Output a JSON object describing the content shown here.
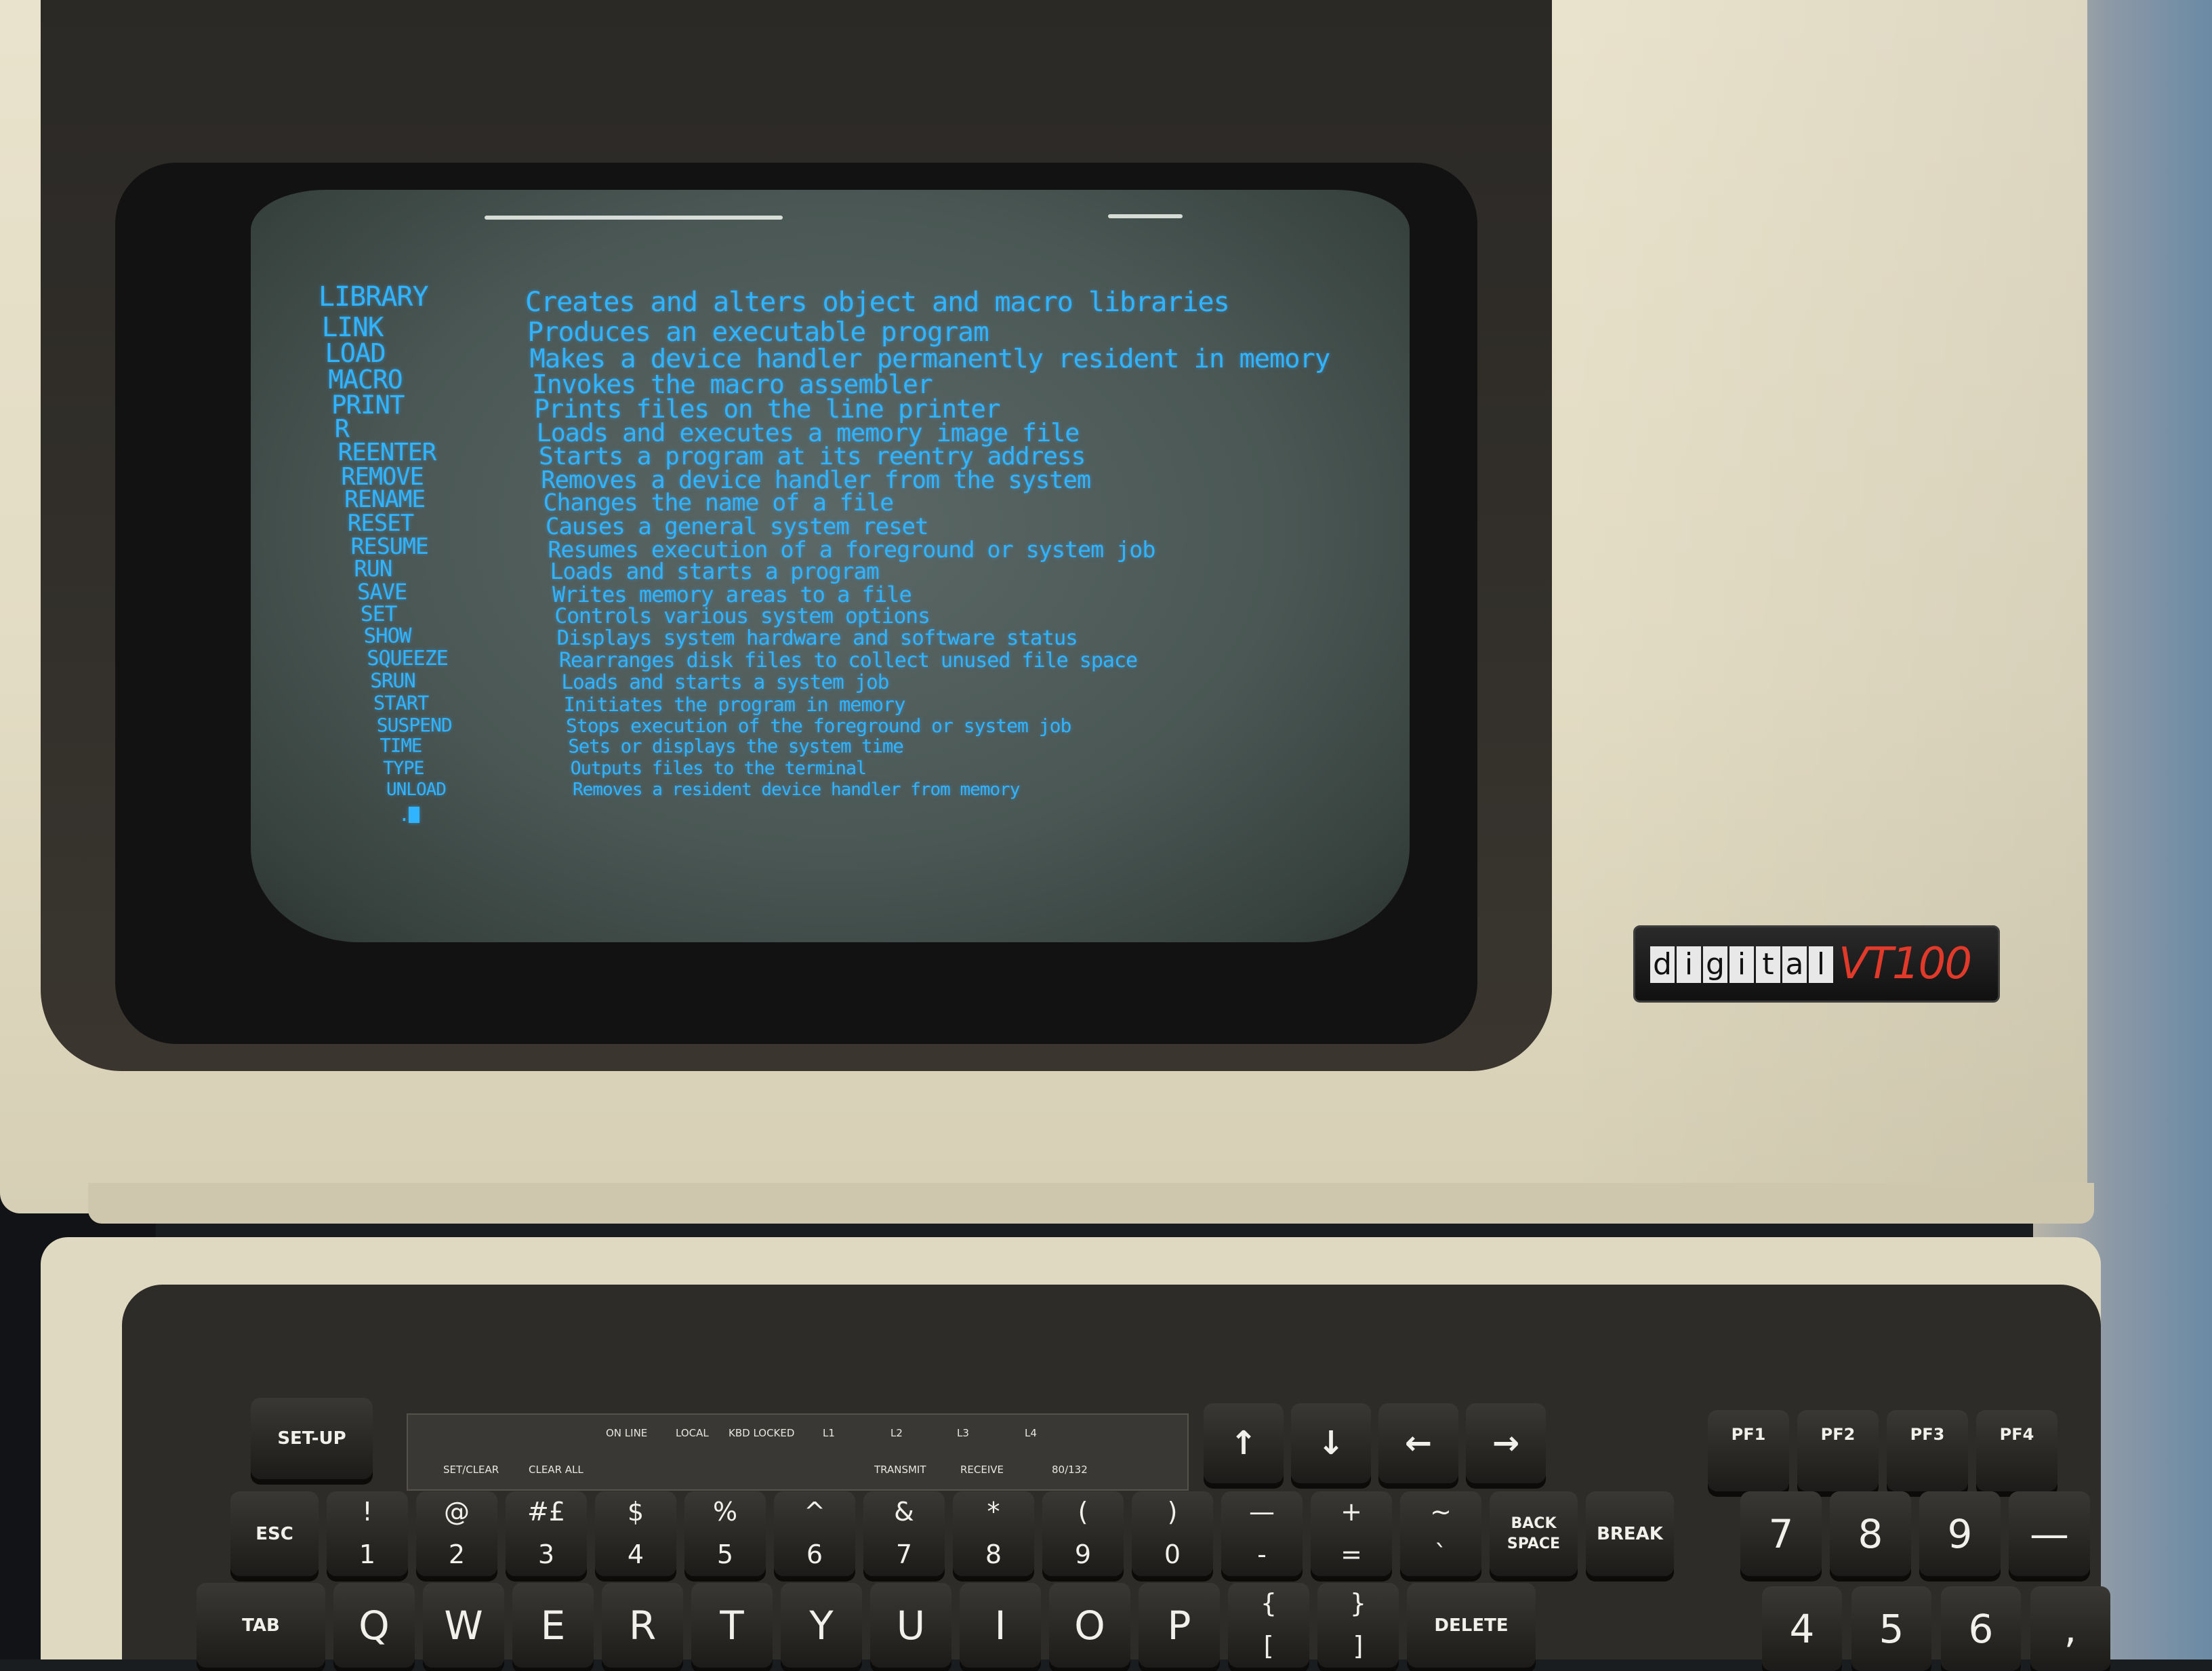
{
  "terminal": {
    "commands": [
      {
        "name": "LIBRARY",
        "description": "Creates and alters object and macro libraries"
      },
      {
        "name": "LINK",
        "description": "Produces an executable program"
      },
      {
        "name": "LOAD",
        "description": "Makes a device handler permanently resident in memory"
      },
      {
        "name": "MACRO",
        "description": "Invokes the macro assembler"
      },
      {
        "name": "PRINT",
        "description": "Prints files on the line printer"
      },
      {
        "name": "R",
        "description": "Loads and executes a memory image file"
      },
      {
        "name": "REENTER",
        "description": "Starts a program at its reentry address"
      },
      {
        "name": "REMOVE",
        "description": "Removes a device handler from the system"
      },
      {
        "name": "RENAME",
        "description": "Changes the name of a file"
      },
      {
        "name": "RESET",
        "description": "Causes a general system reset"
      },
      {
        "name": "RESUME",
        "description": "Resumes execution of a foreground or system job"
      },
      {
        "name": "RUN",
        "description": "Loads and starts a program"
      },
      {
        "name": "SAVE",
        "description": "Writes memory areas to a file"
      },
      {
        "name": "SET",
        "description": "Controls various system options"
      },
      {
        "name": "SHOW",
        "description": "Displays system hardware and software status"
      },
      {
        "name": "SQUEEZE",
        "description": "Rearranges disk files to collect unused file space"
      },
      {
        "name": "SRUN",
        "description": "Loads and starts a system job"
      },
      {
        "name": "START",
        "description": "Initiates the program in memory"
      },
      {
        "name": "SUSPEND",
        "description": "Stops execution of the foreground or system job"
      },
      {
        "name": "TIME",
        "description": "Sets or displays the system time"
      },
      {
        "name": "TYPE",
        "description": "Outputs files to the terminal"
      },
      {
        "name": "UNLOAD",
        "description": "Removes a resident device handler from memory"
      }
    ],
    "prompt": ".",
    "text_color": "#31b4ff",
    "screen_color": "#4f5c59"
  },
  "badge": {
    "brand_letters": [
      "d",
      "i",
      "g",
      "i",
      "t",
      "a",
      "l"
    ],
    "model": "VT100",
    "model_color": "#e23a2a"
  },
  "led_panel": {
    "indicators": [
      "ON LINE",
      "LOCAL",
      "KBD LOCKED",
      "L1",
      "L2",
      "L3",
      "L4"
    ],
    "function_labels": [
      "SET/CLEAR",
      "CLEAR ALL",
      "TRANSMIT",
      "RECEIVE",
      "80/132"
    ]
  },
  "keyboard": {
    "setup": "SET-UP",
    "arrows": [
      "↑",
      "↓",
      "←",
      "→"
    ],
    "pf_keys": [
      "PF1",
      "PF2",
      "PF3",
      "PF4"
    ],
    "number_row": [
      {
        "label": "ESC"
      },
      {
        "top": "!",
        "bottom": "1"
      },
      {
        "top": "@",
        "bottom": "2"
      },
      {
        "top": "#£",
        "bottom": "3"
      },
      {
        "top": "$",
        "bottom": "4"
      },
      {
        "top": "%",
        "bottom": "5"
      },
      {
        "top": "^",
        "bottom": "6"
      },
      {
        "top": "&",
        "bottom": "7"
      },
      {
        "top": "*",
        "bottom": "8"
      },
      {
        "top": "(",
        "bottom": "9"
      },
      {
        "top": ")",
        "bottom": "0"
      },
      {
        "top": "—",
        "bottom": "-"
      },
      {
        "top": "+",
        "bottom": "="
      },
      {
        "top": "~",
        "bottom": "`"
      },
      {
        "label": "BACK SPACE"
      },
      {
        "label": "BREAK"
      }
    ],
    "keypad_row1": [
      "7",
      "8",
      "9",
      "—"
    ],
    "qwerty_row": [
      {
        "label": "TAB"
      },
      {
        "big": "Q"
      },
      {
        "big": "W"
      },
      {
        "big": "E"
      },
      {
        "big": "R"
      },
      {
        "big": "T"
      },
      {
        "big": "Y"
      },
      {
        "big": "U"
      },
      {
        "big": "I"
      },
      {
        "big": "O"
      },
      {
        "big": "P"
      },
      {
        "top": "{",
        "bottom": "["
      },
      {
        "top": "}",
        "bottom": "]"
      },
      {
        "label": "DELETE"
      }
    ],
    "keypad_row2": [
      "4",
      "5",
      "6",
      ","
    ]
  }
}
